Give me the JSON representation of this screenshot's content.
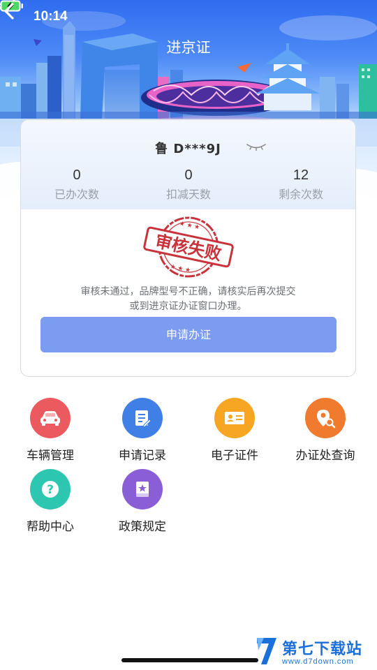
{
  "status_bar": {
    "time": "10:14"
  },
  "header": {
    "title": "进京证"
  },
  "card": {
    "plate": "鲁 D***9J",
    "stats": [
      {
        "value": "0",
        "label": "已办次数"
      },
      {
        "value": "0",
        "label": "扣减天数"
      },
      {
        "value": "12",
        "label": "剩余次数"
      }
    ],
    "stamp_text": "审核失败",
    "message_line1": "审核未通过，品牌型号不正确，请核实后再次提交",
    "message_line2": "或到进京证办证窗口办理。",
    "apply_button": "申请办证"
  },
  "menu": [
    {
      "label": "车辆管理",
      "icon": "car-icon",
      "color": "#ea5a5e"
    },
    {
      "label": "申请记录",
      "icon": "record-icon",
      "color": "#3f7fe6"
    },
    {
      "label": "电子证件",
      "icon": "id-card-icon",
      "color": "#f6a623"
    },
    {
      "label": "办证处查询",
      "icon": "location-search-icon",
      "color": "#f07a2e"
    },
    {
      "label": "帮助中心",
      "icon": "help-icon",
      "color": "#2dc7b1"
    },
    {
      "label": "政策规定",
      "icon": "policy-icon",
      "color": "#8a5ed6"
    }
  ],
  "watermark": {
    "title": "第七下载站",
    "url": "www.d7down.com"
  },
  "colors": {
    "primary_button": "#7b9cf0",
    "stamp_red": "#c9323a"
  }
}
